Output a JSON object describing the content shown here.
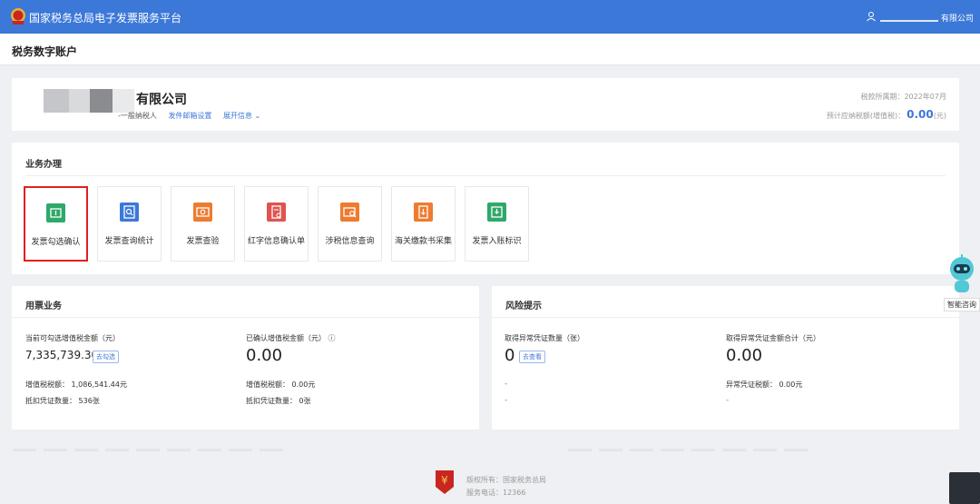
{
  "header": {
    "app_title": "国家税务总局电子发票服务平台",
    "company_suffix": "有限公司"
  },
  "page_title": "税务数字账户",
  "account": {
    "company_name": "有限公司",
    "taxpayer_type": "-一般纳税人",
    "email_link": "发件邮箱设置",
    "expand_link": "展开信息",
    "period_label": "税款所属期：2022年07月",
    "tax_due_label": "预计应纳税额(增值税)：",
    "tax_due_value": "0.00",
    "tax_due_unit": "(元)"
  },
  "business": {
    "title": "业务办理",
    "tiles": [
      {
        "label": "发票勾选确认",
        "color": "#2fa86a",
        "icon": "ticket-icon"
      },
      {
        "label": "发票查询统计",
        "color": "#3c78d8",
        "icon": "search-doc-icon"
      },
      {
        "label": "发票查验",
        "color": "#ee7b30",
        "icon": "verify-icon"
      },
      {
        "label": "红字信息确认单",
        "color": "#e0534f",
        "icon": "red-doc-icon"
      },
      {
        "label": "涉税信息查询",
        "color": "#ee7b30",
        "icon": "search-card-icon"
      },
      {
        "label": "海关缴款书采集",
        "color": "#ee7b30",
        "icon": "customs-icon"
      },
      {
        "label": "发票入账标识",
        "color": "#2fa86a",
        "icon": "inbox-icon"
      }
    ]
  },
  "usage": {
    "title": "用票业务",
    "selectable_label": "当前可勾选增值税金额（元）",
    "selectable_value": "7,335,739.30",
    "selectable_button": "去勾选",
    "confirmed_label": "已确认增值税金额（元）",
    "confirmed_value": "0.00",
    "vat_left": "增值税税额： 1,086,541.44元",
    "count_left": "抵扣凭证数量： 536张",
    "vat_right": "增值税税额： 0.00元",
    "count_right": "抵扣凭证数量： 0张"
  },
  "risk": {
    "title": "风险提示",
    "abnormal_count_label": "取得异常凭证数量（张）",
    "abnormal_count_value": "0",
    "view_button": "去查看",
    "abnormal_amount_label": "取得异常凭证金额合计（元）",
    "abnormal_amount_value": "0.00",
    "dash1": "-",
    "dash2": "-",
    "abnormal_tax": "异常凭证税额： 0.00元",
    "dash3": "-"
  },
  "assistant": {
    "label": "智能咨询"
  },
  "footer": {
    "copyright": "版权所有：国家税务总局",
    "phone": "服务电话：12366"
  },
  "colors": {
    "primary": "#3c78d8",
    "highlight": "#e02020"
  }
}
